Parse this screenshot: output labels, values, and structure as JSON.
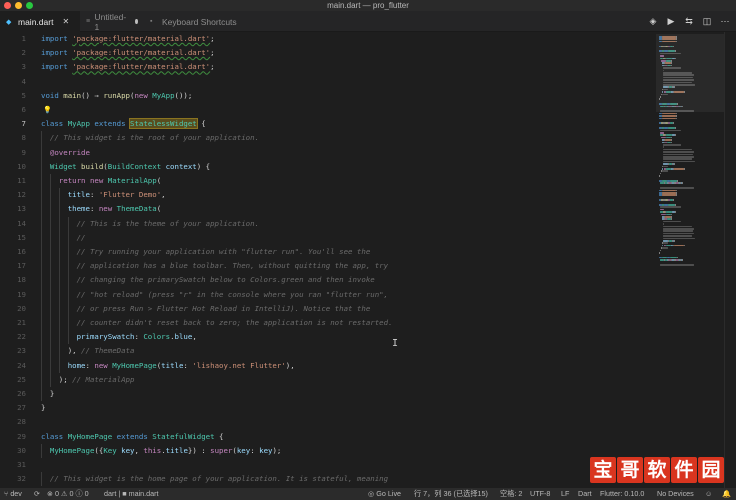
{
  "window": {
    "title": "main.dart — pro_flutter"
  },
  "tabs": [
    {
      "label": "main.dart",
      "state": "active",
      "icon": "dart-file-icon"
    },
    {
      "label": "Untitled-1",
      "state": "dirty",
      "icon": "plain-file-icon"
    },
    {
      "label": "Keyboard Shortcuts",
      "state": "normal",
      "icon": "keyboard-icon"
    }
  ],
  "tab_actions": [
    "debug-icon",
    "run-icon",
    "compare-icon",
    "split-editor-icon",
    "more-icon"
  ],
  "editor": {
    "current_line": 7,
    "lines": [
      {
        "n": "1",
        "tokens": [
          [
            "kb",
            "import "
          ],
          [
            "st",
            "'package:flutter/material.dart'"
          ],
          [
            "df",
            ";"
          ]
        ]
      },
      {
        "n": "2",
        "tokens": [
          [
            "kb",
            "import "
          ],
          [
            "st",
            "'package:flutter/material.dart'"
          ],
          [
            "df",
            ";"
          ]
        ]
      },
      {
        "n": "3",
        "tokens": [
          [
            "kb",
            "import "
          ],
          [
            "st",
            "'package:flutter/material.dart'"
          ],
          [
            "df",
            ";"
          ]
        ]
      },
      {
        "n": "4",
        "tokens": []
      },
      {
        "n": "5",
        "tokens": [
          [
            "kb",
            "void "
          ],
          [
            "fn",
            "main"
          ],
          [
            "df",
            "() ⇒ "
          ],
          [
            "fn",
            "runApp"
          ],
          [
            "df",
            "("
          ],
          [
            "kw",
            "new "
          ],
          [
            "ty",
            "MyApp"
          ],
          [
            "df",
            "());"
          ]
        ]
      },
      {
        "n": "6",
        "tokens": []
      },
      {
        "n": "7",
        "tokens": [
          [
            "kb",
            "class "
          ],
          [
            "ty",
            "MyApp "
          ],
          [
            "kb",
            "extends "
          ],
          [
            "ty",
            "StatelessWidget"
          ],
          [
            "df",
            " {"
          ]
        ]
      },
      {
        "n": "8",
        "tokens": [
          [
            "cg",
            "  // This widget is the root of your application."
          ]
        ]
      },
      {
        "n": "9",
        "tokens": [
          [
            "ann",
            "  @override"
          ]
        ]
      },
      {
        "n": "10",
        "tokens": [
          [
            "ty",
            "  Widget "
          ],
          [
            "fn",
            "build"
          ],
          [
            "df",
            "("
          ],
          [
            "ty",
            "BuildContext "
          ],
          [
            "ps",
            "context"
          ],
          [
            "df",
            ") {"
          ]
        ]
      },
      {
        "n": "11",
        "tokens": [
          [
            "kw",
            "    return new "
          ],
          [
            "ty",
            "MaterialApp"
          ],
          [
            "df",
            "("
          ]
        ]
      },
      {
        "n": "12",
        "tokens": [
          [
            "ps",
            "      title"
          ],
          [
            "df",
            ": "
          ],
          [
            "st",
            "'Flutter Demo'"
          ],
          [
            "df",
            ","
          ]
        ]
      },
      {
        "n": "13",
        "tokens": [
          [
            "ps",
            "      theme"
          ],
          [
            "df",
            ": "
          ],
          [
            "kw",
            "new "
          ],
          [
            "ty",
            "ThemeData"
          ],
          [
            "df",
            "("
          ]
        ]
      },
      {
        "n": "14",
        "tokens": [
          [
            "cg",
            "        // This is the theme of your application."
          ]
        ]
      },
      {
        "n": "15",
        "tokens": [
          [
            "cg",
            "        //"
          ]
        ]
      },
      {
        "n": "16",
        "tokens": [
          [
            "cg",
            "        // Try running your application with \"flutter run\". You'll see the"
          ]
        ]
      },
      {
        "n": "17",
        "tokens": [
          [
            "cg",
            "        // application has a blue toolbar. Then, without quitting the app, try"
          ]
        ]
      },
      {
        "n": "18",
        "tokens": [
          [
            "cg",
            "        // changing the primarySwatch below to Colors.green and then invoke"
          ]
        ]
      },
      {
        "n": "19",
        "tokens": [
          [
            "cg",
            "        // \"hot reload\" (press \"r\" in the console where you ran \"flutter run\","
          ]
        ]
      },
      {
        "n": "20",
        "tokens": [
          [
            "cg",
            "        // or press Run > Flutter Hot Reload in IntelliJ). Notice that the"
          ]
        ]
      },
      {
        "n": "21",
        "tokens": [
          [
            "cg",
            "        // counter didn't reset back to zero; the application is not restarted."
          ]
        ]
      },
      {
        "n": "22",
        "tokens": [
          [
            "ps",
            "        primarySwatch"
          ],
          [
            "df",
            ": "
          ],
          [
            "ty",
            "Colors"
          ],
          [
            "df",
            "."
          ],
          [
            "ps",
            "blue"
          ],
          [
            "df",
            ","
          ]
        ]
      },
      {
        "n": "23",
        "tokens": [
          [
            "df",
            "      ), "
          ],
          [
            "cg",
            "// ThemeData"
          ]
        ]
      },
      {
        "n": "24",
        "tokens": [
          [
            "ps",
            "      home"
          ],
          [
            "df",
            ": "
          ],
          [
            "kw",
            "new "
          ],
          [
            "ty",
            "MyHomePage"
          ],
          [
            "df",
            "("
          ],
          [
            "ps",
            "title"
          ],
          [
            "df",
            ": "
          ],
          [
            "st",
            "'lishaoy.net Flutter'"
          ],
          [
            "df",
            "),"
          ]
        ]
      },
      {
        "n": "25",
        "tokens": [
          [
            "df",
            "    ); "
          ],
          [
            "cg",
            "// MaterialApp"
          ]
        ]
      },
      {
        "n": "26",
        "tokens": [
          [
            "df",
            "  }"
          ]
        ]
      },
      {
        "n": "27",
        "tokens": [
          [
            "df",
            "}"
          ]
        ]
      },
      {
        "n": "28",
        "tokens": []
      },
      {
        "n": "29",
        "tokens": [
          [
            "kb",
            "class "
          ],
          [
            "ty",
            "MyHomePage "
          ],
          [
            "kb",
            "extends "
          ],
          [
            "ty",
            "StatefulWidget"
          ],
          [
            "df",
            " {"
          ]
        ]
      },
      {
        "n": "30",
        "tokens": [
          [
            "ty",
            "  MyHomePage"
          ],
          [
            "df",
            "({"
          ],
          [
            "ty",
            "Key "
          ],
          [
            "ps",
            "key"
          ],
          [
            "df",
            ", "
          ],
          [
            "kw",
            "this"
          ],
          [
            "df",
            "."
          ],
          [
            "ps",
            "title"
          ],
          [
            "df",
            "}) : "
          ],
          [
            "kw",
            "super"
          ],
          [
            "df",
            "("
          ],
          [
            "ps",
            "key"
          ],
          [
            "df",
            ": "
          ],
          [
            "ps",
            "key"
          ],
          [
            "df",
            ");"
          ]
        ]
      },
      {
        "n": "31",
        "tokens": []
      },
      {
        "n": "32",
        "tokens": [
          [
            "cg",
            "  // This widget is the home page of your application. It is stateful, meaning"
          ]
        ]
      }
    ]
  },
  "statusbar": {
    "left": [
      {
        "icon": "branch-icon",
        "label": "dev"
      },
      {
        "icon": "sync-icon",
        "label": ""
      },
      {
        "icon": "error-icon",
        "label": "0"
      },
      {
        "icon": "warning-icon",
        "label": "0"
      },
      {
        "icon": "info-icon",
        "label": "0"
      },
      {
        "icon": "folder-icon",
        "label": "dart | ■ main.dart"
      }
    ],
    "golive": "Go Live",
    "position": "行 7，列 36 (已选择15)",
    "spaces": "空格: 2",
    "encoding": "UTF-8",
    "eol": "LF",
    "language": "Dart",
    "flutter": "Flutter: 0.10.0",
    "devices": "No Devices"
  },
  "watermark": {
    "text": "宝哥软件园"
  },
  "colors": {
    "keyword": "#569cd6",
    "control": "#c586c0",
    "type": "#4ec9b0",
    "function": "#dcdcaa",
    "string": "#ce9178",
    "comment": "#6b6b6b",
    "param": "#9cdcfe",
    "selection": "#5a4d1e"
  }
}
